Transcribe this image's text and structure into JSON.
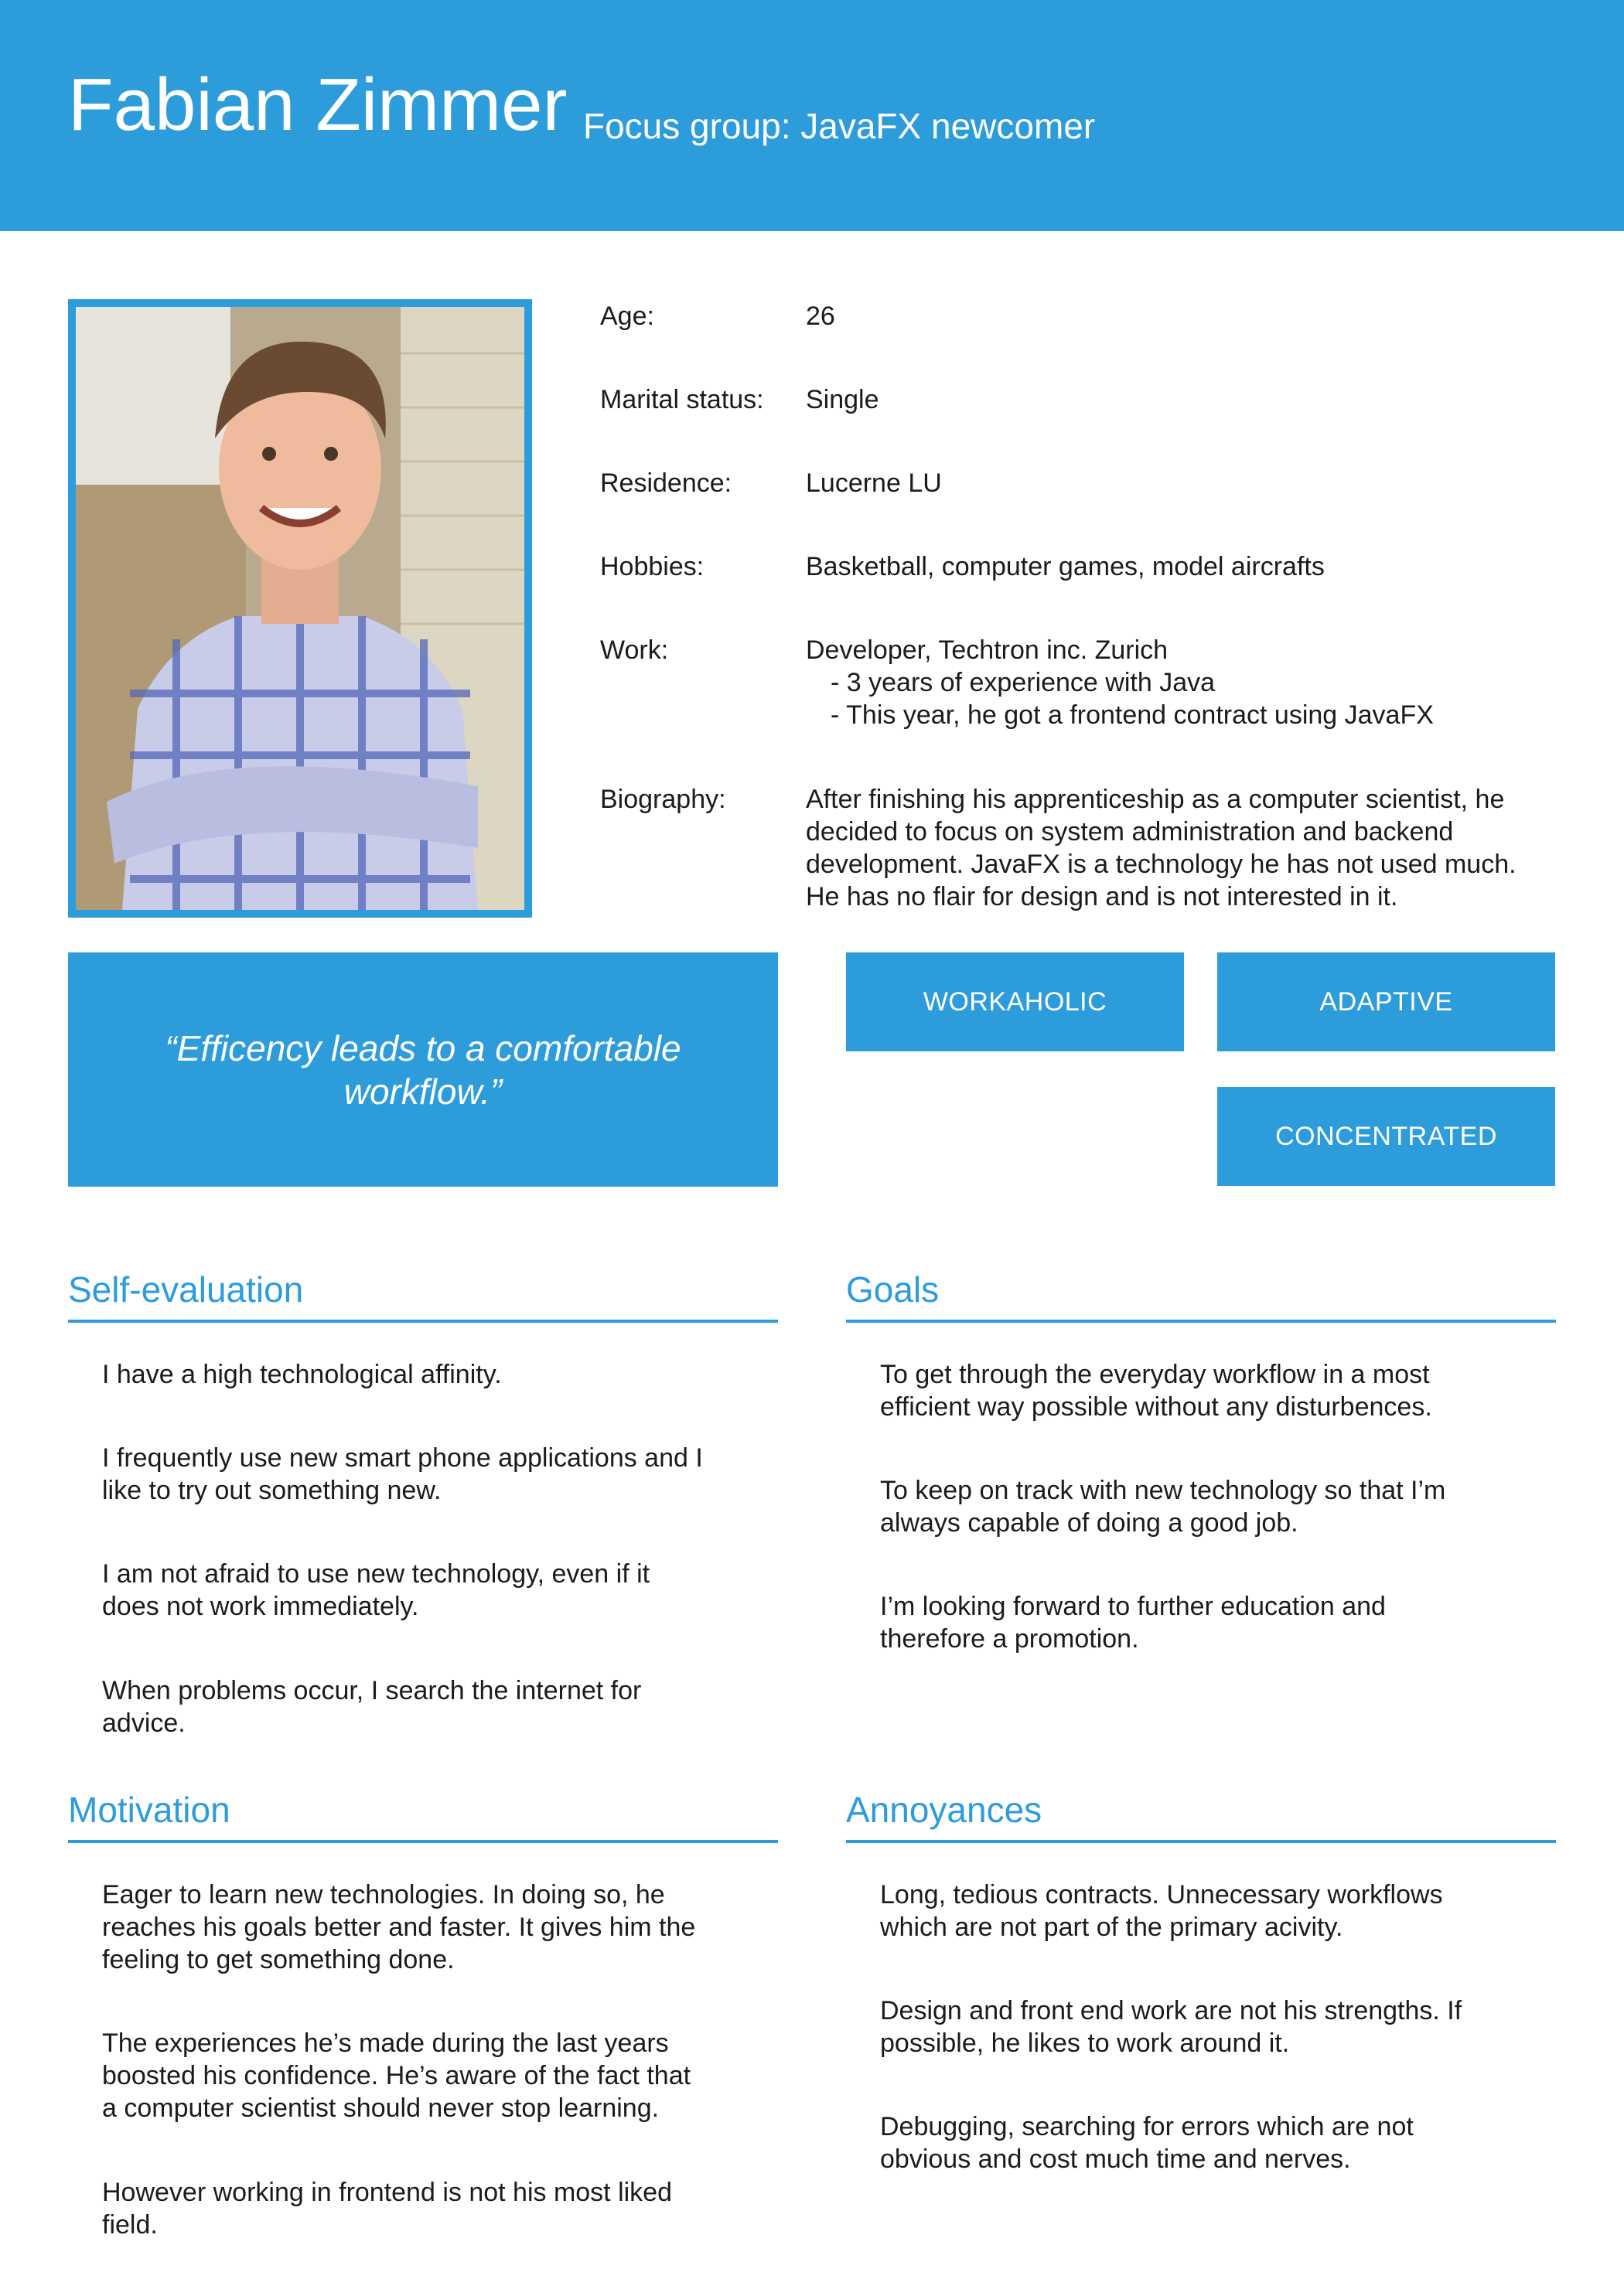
{
  "header": {
    "name": "Fabian Zimmer",
    "focus_group": "Focus group: JavaFX newcomer"
  },
  "photo": {
    "description_icon": "portrait-photo"
  },
  "info": {
    "age_label": "Age:",
    "age": "26",
    "marital_label": "Marital status:",
    "marital": "Single",
    "residence_label": "Residence:",
    "residence": "Lucerne LU",
    "hobbies_label": "Hobbies:",
    "hobbies": "Basketball, computer games, model aircrafts",
    "work_label": "Work:",
    "work_lines": [
      "Developer, Techtron inc. Zurich",
      "- 3 years of experience with Java",
      "- This year, he got a frontend contract using JavaFX"
    ],
    "bio_label": "Biography:",
    "bio_lines": [
      "After finishing his apprenticeship as a computer scientist, he",
      "decided to focus on system administration and backend",
      "development. JavaFX is a technology he has not used much.",
      "He has no flair for design and is not interested in it."
    ]
  },
  "quote": "“Efficency leads to a comfortable workflow.”",
  "tags": [
    "WORKAHOLIC",
    "ADAPTIVE",
    "CONCENTRATED"
  ],
  "sections": {
    "self_evaluation": {
      "title": "Self-evaluation",
      "items": [
        [
          "I have a high technological affinity."
        ],
        [
          "I frequently use new smart phone applications and I",
          "like to try out something new."
        ],
        [
          "I am not afraid to use new technology, even if it",
          "does not work immediately."
        ],
        [
          "When problems occur, I search the internet for",
          "advice."
        ]
      ]
    },
    "goals": {
      "title": "Goals",
      "items": [
        [
          "To get through the everyday workflow in a most",
          "efficient way possible without any disturbences."
        ],
        [
          "To keep on track with new technology so that I’m",
          "always capable of doing a good job."
        ],
        [
          "I’m looking forward to further education and",
          "therefore a promotion."
        ]
      ]
    },
    "motivation": {
      "title": "Motivation",
      "items": [
        [
          "Eager to learn new technologies. In doing so, he",
          "reaches his goals better and faster. It gives him the",
          "feeling to get something done."
        ],
        [
          "The experiences he’s made during the last years",
          "boosted his confidence. He’s aware of the fact that",
          "a computer scientist should never stop learning."
        ],
        [
          "However working in frontend is not his most liked",
          "field."
        ]
      ]
    },
    "annoyances": {
      "title": "Annoyances",
      "items": [
        [
          "Long, tedious contracts. Unnecessary workflows",
          "which are not part of the primary acivity."
        ],
        [
          "Design and front end work are not his strengths. If",
          "possible, he likes to work around it."
        ],
        [
          "Debugging, searching for errors which are not",
          "obvious and cost much time and nerves."
        ]
      ]
    }
  },
  "colors": {
    "accent": "#2d9cdb",
    "text": "#1b1b1b",
    "background": "#ffffff"
  }
}
